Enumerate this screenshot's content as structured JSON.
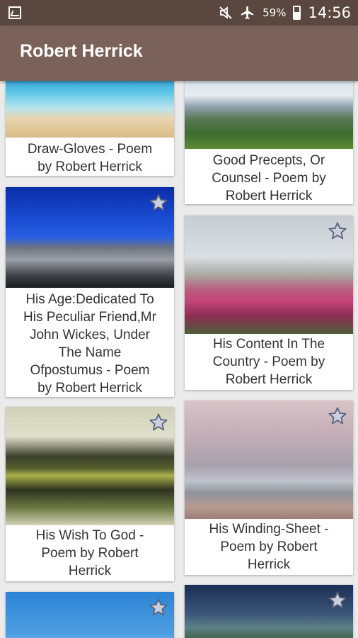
{
  "status_bar": {
    "battery_percent": "59%",
    "time": "14:56",
    "icons": [
      "image-icon",
      "mute-icon",
      "airplane-icon",
      "battery-icon"
    ]
  },
  "app_bar": {
    "title": "Robert Herrick"
  },
  "colors": {
    "status_bar": "#5a4740",
    "app_bar": "#7a625a",
    "background": "#ebebeb",
    "star_fill": "#c9cfe0",
    "star_stroke": "#5a5f78"
  },
  "poems": [
    {
      "title": "Draw-Gloves - Poem by Robert Herrick",
      "lines": [
        "Draw-Gloves - Poem",
        "by Robert Herrick"
      ],
      "image": "beach-photo",
      "favorite_icon": false
    },
    {
      "title": "Good Precepts, Or Counsel - Poem by Robert Herrick",
      "lines": [
        "Good Precepts, Or",
        "Counsel - Poem by",
        "Robert Herrick"
      ],
      "image": "mountain-valley-photo",
      "favorite_icon": false
    },
    {
      "title": "His Age:Dedicated To His Peculiar Friend,Mr John Wickes, Under The Name Ofpostumus - Poem by Robert Herrick",
      "lines": [
        "His Age:Dedicated To",
        "His Peculiar Friend,Mr",
        "John Wickes, Under",
        "The Name",
        "Ofpostumus - Poem",
        "by Robert Herrick"
      ],
      "image": "blue-sky-mountain-photo",
      "favorite_icon": true
    },
    {
      "title": "His Content In The Country - Poem by Robert Herrick",
      "lines": [
        "His Content In The",
        "Country - Poem by",
        "Robert Herrick"
      ],
      "image": "flower-field-photo",
      "favorite_icon": true
    },
    {
      "title": "His Wish To God - Poem by Robert Herrick",
      "lines": [
        "His Wish To God -",
        "Poem by Robert",
        "Herrick"
      ],
      "image": "lake-reflection-photo",
      "favorite_icon": true
    },
    {
      "title": "His Winding-Sheet - Poem by Robert Herrick",
      "lines": [
        "His Winding-Sheet -",
        "Poem by Robert",
        "Herrick"
      ],
      "image": "pink-sky-mountains-photo",
      "favorite_icon": true
    },
    {
      "title": "",
      "lines": [],
      "image": "blue-sky-photo",
      "favorite_icon": true
    },
    {
      "title": "",
      "lines": [],
      "image": "valley-landscape-photo",
      "favorite_icon": true
    }
  ]
}
